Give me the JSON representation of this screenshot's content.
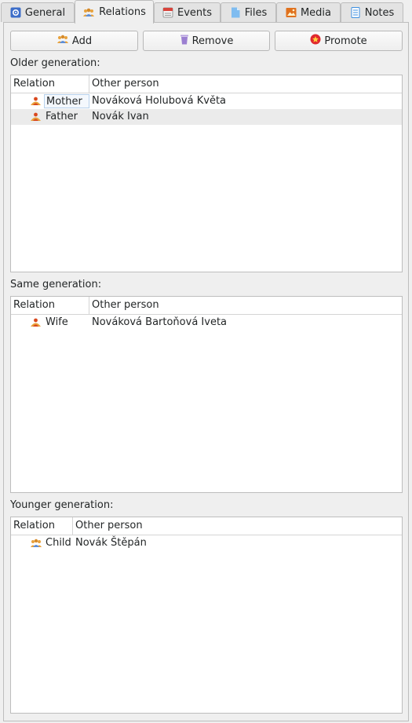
{
  "tabs": [
    {
      "label": "General",
      "icon": "gear-icon"
    },
    {
      "label": "Relations",
      "icon": "people-icon"
    },
    {
      "label": "Events",
      "icon": "calendar-icon"
    },
    {
      "label": "Files",
      "icon": "file-icon"
    },
    {
      "label": "Media",
      "icon": "image-icon"
    },
    {
      "label": "Notes",
      "icon": "notes-icon"
    }
  ],
  "active_tab": "Relations",
  "toolbar": {
    "add_label": "Add",
    "remove_label": "Remove",
    "promote_label": "Promote"
  },
  "sections": {
    "older": {
      "label": "Older generation:",
      "headers": {
        "relation": "Relation",
        "other": "Other person"
      },
      "rows": [
        {
          "relation": "Mother",
          "other": "Nováková Holubová Květa",
          "icon": "female-relation-icon"
        },
        {
          "relation": "Father",
          "other": "Novák Ivan",
          "icon": "male-relation-icon"
        }
      ]
    },
    "same": {
      "label": "Same generation:",
      "headers": {
        "relation": "Relation",
        "other": "Other person"
      },
      "rows": [
        {
          "relation": "Wife",
          "other": "Nováková Bartoňová Iveta",
          "icon": "female-relation-icon"
        }
      ]
    },
    "younger": {
      "label": "Younger generation:",
      "headers": {
        "relation": "Relation",
        "other": "Other person"
      },
      "rows": [
        {
          "relation": "Child",
          "other": "Novák Štěpán",
          "icon": "child-relation-icon"
        }
      ]
    }
  },
  "colors": {
    "people_icon": "#e8a23c",
    "relation_icon": "#d9481e",
    "remove_icon": "#9b7fd1",
    "promote_icon": "#e0282e",
    "gear_icon": "#3d6ec9",
    "calendar_icon": "#d8433c",
    "file_icon": "#5aa6e6",
    "media_icon": "#e0711d",
    "notes_icon": "#3d8fe0"
  }
}
